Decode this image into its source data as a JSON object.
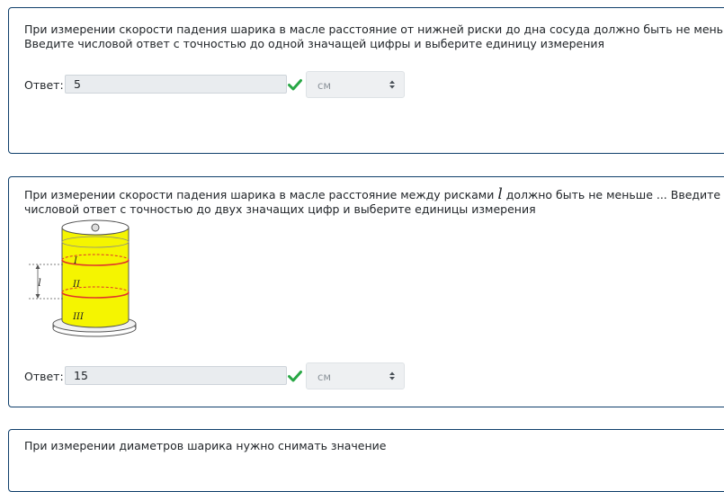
{
  "questions": [
    {
      "text_line1": "При измерении скорости падения шарика в масле расстояние от нижней риски до дна сосуда должно быть не меньше ...",
      "text_line2": "Введите числовой ответ с точностью до одной значащей цифры и выберите единицу измерения",
      "answer_label": "Ответ:",
      "answer_value": "5",
      "unit": "см",
      "status": "correct"
    },
    {
      "text_line1_before": " При измерении скорости падения шарика в масле расстояние между рисками ",
      "variable": "l",
      "text_line1_after": " должно быть не меньше  ...  Введите",
      "text_line2": "числовой ответ с точностью до двух значащих цифр и  выберите  единицы измерения",
      "figure_labels": [
        "l",
        "I",
        "II",
        "III"
      ],
      "answer_label": "Ответ:",
      "answer_value": "15",
      "unit": "см",
      "status": "correct"
    },
    {
      "text_line1": "При измерении диаметров шарика нужно снимать значение"
    }
  ],
  "colors": {
    "card_border": "#0f3f6b",
    "check": "#28a745",
    "oil": "#f5f500",
    "mark_line": "#e0342b"
  },
  "icons": {
    "status": "checkmark-icon",
    "select": "updown-caret-icon"
  }
}
